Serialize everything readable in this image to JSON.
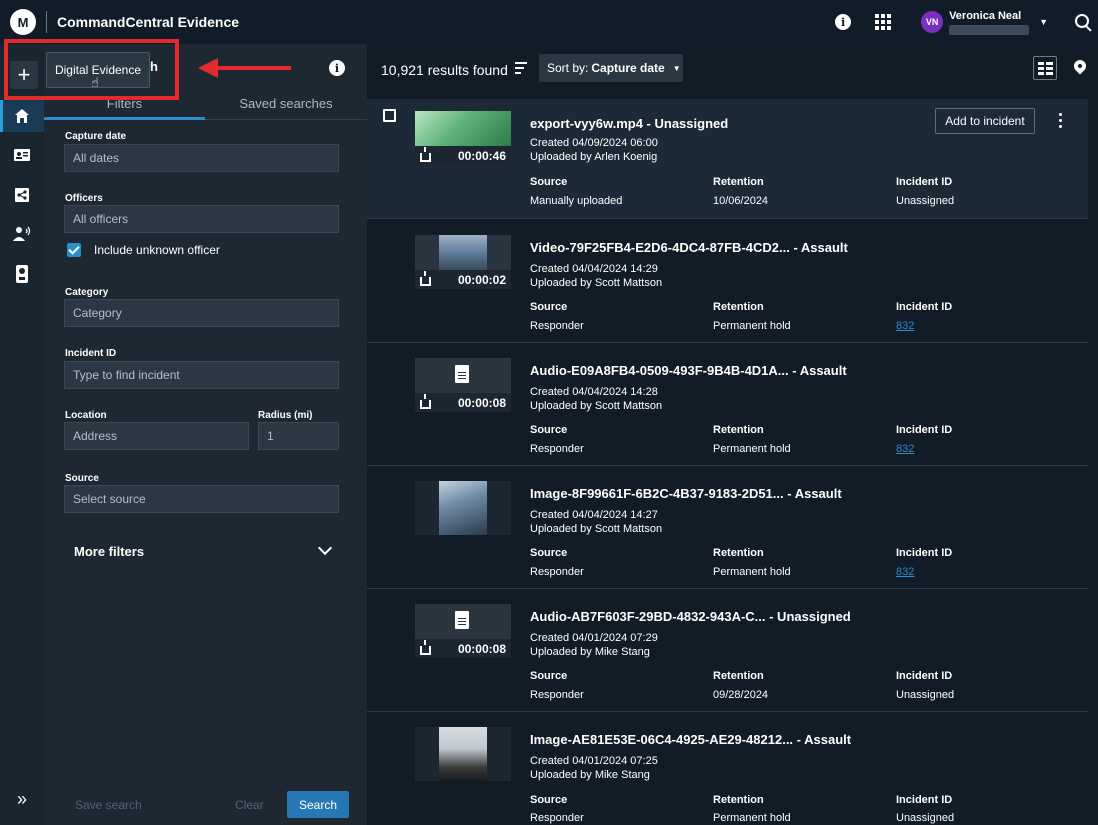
{
  "header": {
    "logo": "M",
    "title": "CommandCentral Evidence",
    "info": "i",
    "user": {
      "initials": "VN",
      "name": "Veronica Neal"
    }
  },
  "rail": {
    "add_icon": "+",
    "expand_icon": "»"
  },
  "tooltip": {
    "label": "Digital Evidence",
    "title_fragment": "h"
  },
  "filters": {
    "info": "i",
    "tabs": {
      "filters": "Filters",
      "saved": "Saved searches"
    },
    "capture_date": {
      "label": "Capture date",
      "value": "All dates"
    },
    "officers": {
      "label": "Officers",
      "value": "All officers"
    },
    "include_unknown": {
      "label": "Include unknown officer",
      "checked": true
    },
    "category": {
      "label": "Category",
      "placeholder": "Category"
    },
    "incident_id": {
      "label": "Incident ID",
      "placeholder": "Type to find incident"
    },
    "location": {
      "label": "Location",
      "placeholder": "Address"
    },
    "radius": {
      "label": "Radius (mi)",
      "value": "1"
    },
    "source": {
      "label": "Source",
      "placeholder": "Select source"
    },
    "more_filters": "More filters",
    "save_search": "Save search",
    "clear": "Clear",
    "search": "Search"
  },
  "results": {
    "count": "10,921 results found",
    "sort_prefix": "Sort by:",
    "sort_value": "Capture date",
    "col_source": "Source",
    "col_retention": "Retention",
    "col_incident": "Incident ID",
    "add_to_incident": "Add to incident",
    "items": [
      {
        "title": "export-vyy6w.mp4 - Unassigned",
        "created": "Created 04/09/2024 06:00",
        "uploaded": "Uploaded by Arlen Koenig",
        "duration": "00:00:46",
        "source": "Manually uploaded",
        "retention": "10/06/2024",
        "incident": "Unassigned"
      },
      {
        "title": "Video-79F25FB4-E2D6-4DC4-87FB-4CD2... - Assault",
        "created": "Created 04/04/2024 14:29",
        "uploaded": "Uploaded by Scott Mattson",
        "duration": "00:00:02",
        "source": "Responder",
        "retention": "Permanent hold",
        "incident": "832"
      },
      {
        "title": "Audio-E09A8FB4-0509-493F-9B4B-4D1A... - Assault",
        "created": "Created 04/04/2024 14:28",
        "uploaded": "Uploaded by Scott Mattson",
        "duration": "00:00:08",
        "source": "Responder",
        "retention": "Permanent hold",
        "incident": "832"
      },
      {
        "title": "Image-8F99661F-6B2C-4B37-9183-2D51... - Assault",
        "created": "Created 04/04/2024 14:27",
        "uploaded": "Uploaded by Scott Mattson",
        "duration": "",
        "source": "Responder",
        "retention": "Permanent hold",
        "incident": "832"
      },
      {
        "title": "Audio-AB7F603F-29BD-4832-943A-C... - Unassigned",
        "created": "Created 04/01/2024 07:29",
        "uploaded": "Uploaded by Mike Stang",
        "duration": "00:00:08",
        "source": "Responder",
        "retention": "09/28/2024",
        "incident": "Unassigned"
      },
      {
        "title": "Image-AE81E53E-06C4-4925-AE29-48212... - Assault",
        "created": "Created 04/01/2024 07:25",
        "uploaded": "Uploaded by Mike Stang",
        "duration": "",
        "source": "Responder",
        "retention": "Permanent hold",
        "incident": "Unassigned"
      }
    ]
  }
}
